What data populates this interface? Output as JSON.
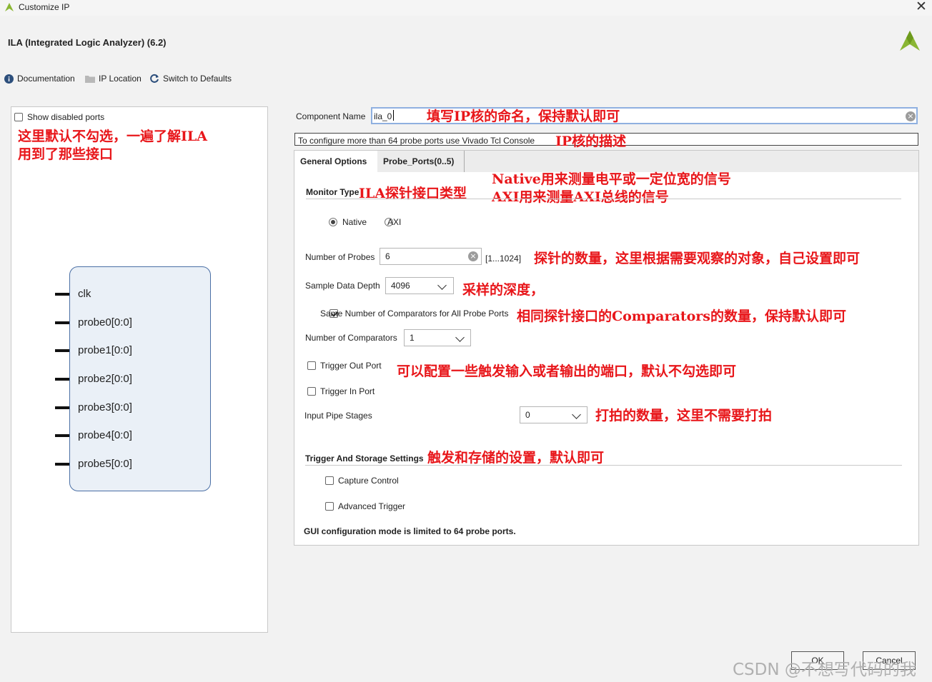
{
  "window": {
    "title": "Customize IP",
    "close_glyph": "✕",
    "logo_icon": "vivado-logo-icon"
  },
  "header": {
    "ip_name": "ILA (Integrated Logic Analyzer) (6.2)"
  },
  "toolbar": {
    "documentation": "Documentation",
    "ip_location": "IP Location",
    "switch_defaults": "Switch to Defaults"
  },
  "left": {
    "show_disabled_ports": "Show disabled ports",
    "show_disabled_checked": false,
    "annotation_line1": "这里默认不勾选，一遍了解ILA",
    "annotation_line2": "用到了那些接口",
    "ports": [
      "clk",
      "probe0[0:0]",
      "probe1[0:0]",
      "probe2[0:0]",
      "probe3[0:0]",
      "probe4[0:0]",
      "probe5[0:0]"
    ]
  },
  "form": {
    "component_name_label": "Component Name",
    "component_name_value": "ila_0",
    "component_name_note": "填写IP核的命名，保持默认即可",
    "description": "To configure more than 64 probe ports use Vivado Tcl Console",
    "description_note": "IP核的描述",
    "tabs": [
      "General Options",
      "Probe_Ports(0..5)"
    ],
    "monitor_type_label": "Monitor Type",
    "monitor_type_note": "ILA探针接口类型",
    "native_note": "Native用来测量电平或一定位宽的信号",
    "axi_note": "AXI用来测量AXI总线的信号",
    "radio_native": "Native",
    "radio_axi": "AXI",
    "selected_monitor": "Native",
    "num_probes_label": "Number of Probes",
    "num_probes_value": "6",
    "num_probes_range": "[1...1024]",
    "num_probes_note": "探针的数量，这里根据需要观察的对象，自己设置即可",
    "sample_depth_label": "Sample Data Depth",
    "sample_depth_value": "4096",
    "sample_depth_note": "采样的深度，",
    "same_comparators_label": "Same Number of Comparators for All Probe Ports",
    "same_comparators_checked": true,
    "same_comparators_note": "相同探针接口的Comparators的数量，保持默认即可",
    "num_comparators_label": "Number of Comparators",
    "num_comparators_value": "1",
    "trigger_out_label": "Trigger Out Port",
    "trigger_out_checked": false,
    "trigger_note": "可以配置一些触发输入或者输出的端口，默认不勾选即可",
    "trigger_in_label": "Trigger In Port",
    "trigger_in_checked": false,
    "pipe_stages_label": "Input Pipe Stages",
    "pipe_stages_value": "0",
    "pipe_stages_note": "打拍的数量，这里不需要打拍",
    "trigger_storage_label": "Trigger And Storage Settings",
    "trigger_storage_note": "触发和存储的设置，默认即可",
    "capture_control_label": "Capture Control",
    "capture_control_checked": false,
    "advanced_trigger_label": "Advanced Trigger",
    "advanced_trigger_checked": false,
    "gui_limit_note": "GUI configuration mode is limited to 64 probe ports."
  },
  "buttons": {
    "ok": "OK",
    "cancel": "Cancel"
  },
  "watermark": "CSDN @不想写代码的我",
  "colors": {
    "annotation": "#e8161a",
    "logo_green": "#8ab633"
  }
}
